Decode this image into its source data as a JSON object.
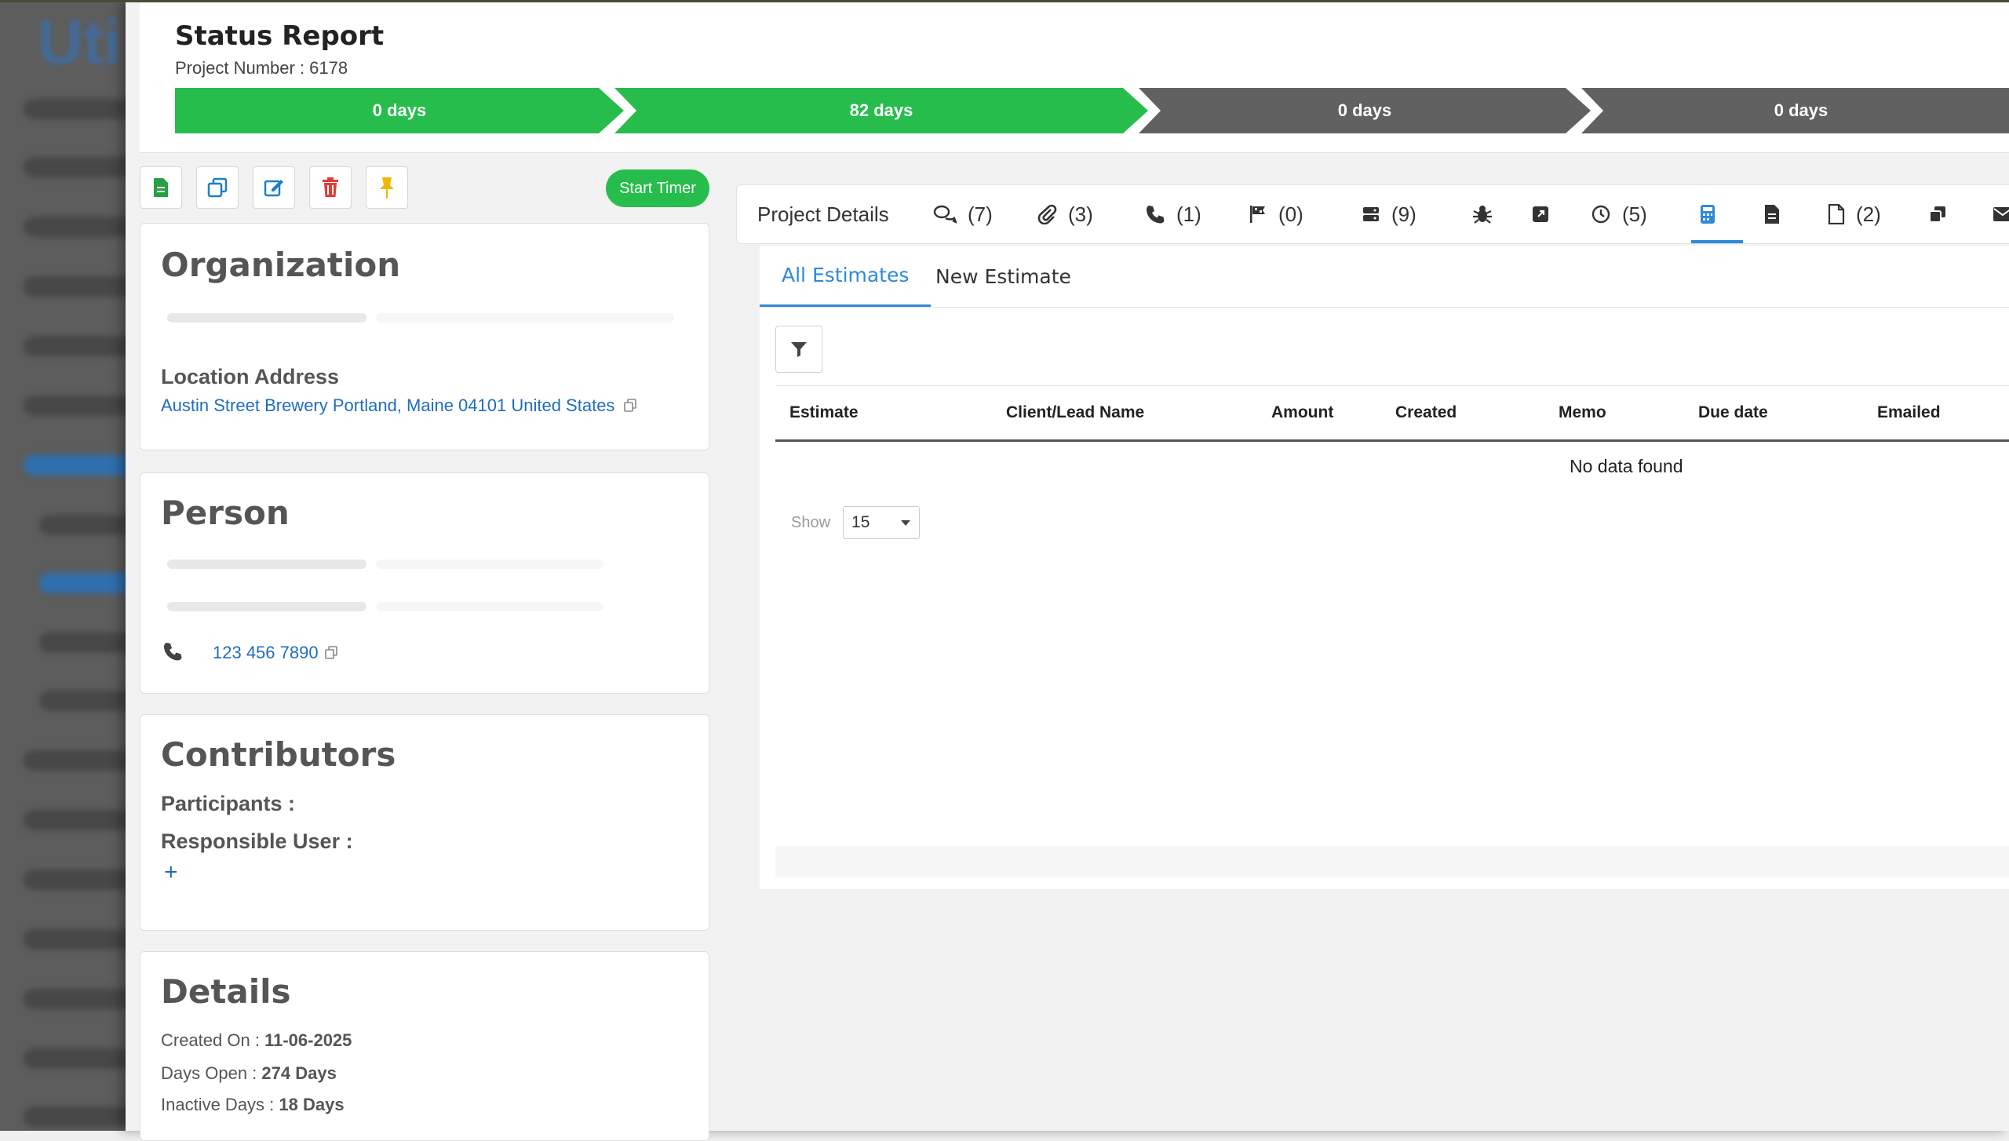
{
  "header": {
    "title": "Status Report",
    "project_number": "Project Number : 6178",
    "stages": [
      "0 days",
      "82 days",
      "0 days",
      "0 days"
    ]
  },
  "toolbar": {
    "start_timer": "Start Timer"
  },
  "organization": {
    "heading": "Organization",
    "location_label": "Location Address",
    "address": "Austin Street Brewery Portland, Maine 04101 United States"
  },
  "person": {
    "heading": "Person",
    "phone": "123 456 7890"
  },
  "contributors": {
    "heading": "Contributors",
    "participants_label": "Participants :",
    "responsible_label": "Responsible User :",
    "add": "+"
  },
  "details": {
    "heading": "Details",
    "created_label": "Created On :",
    "created_value": "11-06-2025",
    "open_label": "Days Open :",
    "open_value": "274 Days",
    "inactive_label": "Inactive Days :",
    "inactive_value": "18 Days"
  },
  "tabs": {
    "project_details": "Project Details",
    "comments": "(7)",
    "attachments": "(3)",
    "calls": "(1)",
    "milestones": "(0)",
    "servers": "(9)",
    "time": "(5)",
    "files": "(2)"
  },
  "estimates": {
    "tab_all": "All Estimates",
    "tab_new": "New Estimate",
    "columns": [
      "Estimate",
      "Client/Lead Name",
      "Amount",
      "Created",
      "Memo",
      "Due date",
      "Emailed"
    ],
    "empty": "No data found",
    "show_label": "Show",
    "page_size": "15"
  },
  "colors": {
    "green": "#27bd4c",
    "gray": "#616161",
    "accent": "#2d8ad6"
  }
}
